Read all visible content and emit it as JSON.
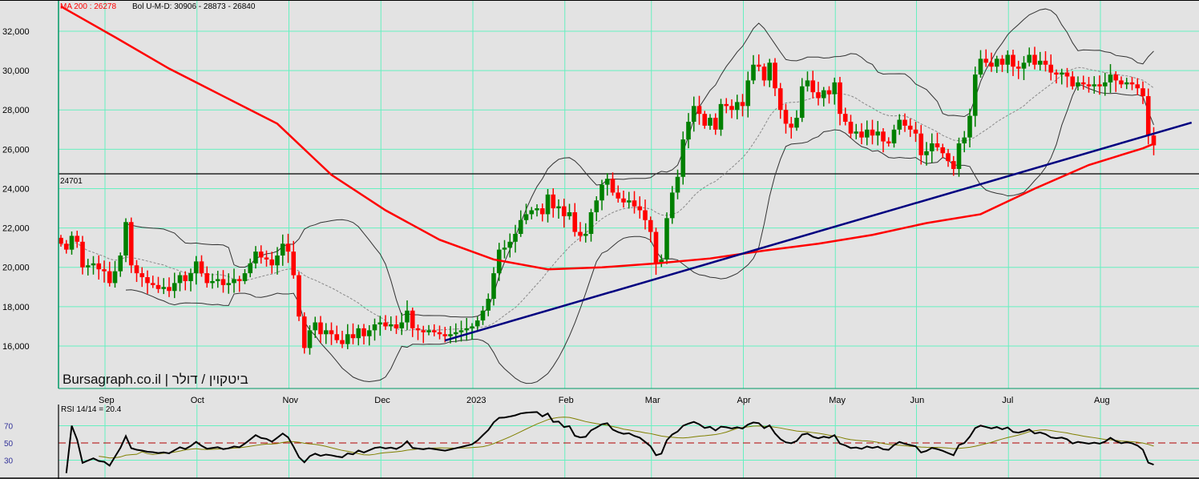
{
  "chart_data": {
    "type": "candlestick",
    "title": "Bursagraph.co.il | ביטקוין / דולר",
    "brand": "Bursagraph.co.il",
    "instrument": "ביטקוין / דולר",
    "legend": {
      "ma_label": "MA 200 : 26278",
      "bol_label": "Bol U-M-D: 30906 - 28873 - 26840",
      "rsi_label": "RSI 14/14 = 20.4"
    },
    "y_ticks": [
      "32,000",
      "30,000",
      "28,000",
      "26,000",
      "24,000",
      "22,000",
      "20,000",
      "18,000",
      "16,000"
    ],
    "y_tick_values": [
      32000,
      30000,
      28000,
      26000,
      24000,
      22000,
      20000,
      18000,
      16000
    ],
    "ylim": [
      13800,
      33600
    ],
    "reference_line": {
      "value": 24701,
      "label": "24701"
    },
    "x_months": [
      {
        "label": "Sep",
        "index": 8
      },
      {
        "label": "Oct",
        "index": 25
      },
      {
        "label": "Nov",
        "index": 42
      },
      {
        "label": "Dec",
        "index": 59
      },
      {
        "label": "2023",
        "index": 76
      },
      {
        "label": "Feb",
        "index": 93
      },
      {
        "label": "Mar",
        "index": 109
      },
      {
        "label": "Apr",
        "index": 126
      },
      {
        "label": "May",
        "index": 143
      },
      {
        "label": "Jun",
        "index": 158
      },
      {
        "label": "Jul",
        "index": 175
      },
      {
        "label": "Aug",
        "index": 192
      }
    ],
    "closes": [
      21200,
      20900,
      21600,
      21300,
      20000,
      20100,
      20200,
      19900,
      19800,
      19200,
      19800,
      20600,
      22300,
      20100,
      19700,
      19500,
      19200,
      19100,
      18900,
      19000,
      18800,
      19200,
      19600,
      19300,
      19700,
      20300,
      19700,
      19200,
      19300,
      19400,
      19100,
      19200,
      19400,
      19300,
      19700,
      20200,
      20800,
      20500,
      20400,
      20100,
      20600,
      21200,
      20800,
      19600,
      17500,
      15900,
      16800,
      17200,
      16600,
      16800,
      16600,
      16300,
      16100,
      16600,
      16400,
      16900,
      16500,
      16800,
      17100,
      17200,
      17000,
      17100,
      16900,
      17200,
      17800,
      16900,
      16800,
      16700,
      16800,
      16700,
      16600,
      16500,
      16600,
      16700,
      16800,
      16900,
      17000,
      17300,
      17800,
      18400,
      19700,
      20900,
      21000,
      21300,
      21700,
      22400,
      22700,
      22900,
      23000,
      22700,
      23700,
      23000,
      23100,
      22600,
      22800,
      21800,
      21600,
      21700,
      22800,
      23400,
      24200,
      24500,
      23800,
      23500,
      23300,
      23400,
      23100,
      22900,
      22400,
      21800,
      20200,
      20400,
      22500,
      23800,
      24600,
      26500,
      27400,
      28200,
      27800,
      27200,
      27600,
      27000,
      28300,
      28200,
      28000,
      28400,
      28200,
      29500,
      30300,
      30200,
      29500,
      30400,
      29100,
      28000,
      27300,
      27100,
      27600,
      29200,
      29500,
      28900,
      28600,
      29000,
      28800,
      29400,
      27800,
      27400,
      26800,
      26900,
      26600,
      27000,
      26700,
      26900,
      26400,
      26300,
      27000,
      27500,
      27200,
      27000,
      26800,
      25700,
      25900,
      26300,
      26100,
      25800,
      25400,
      25000,
      26300,
      26600,
      27700,
      29800,
      30600,
      30400,
      30200,
      30600,
      30300,
      30800,
      30200,
      30100,
      30400,
      30800,
      30300,
      30500,
      30300,
      29900,
      29800,
      29900,
      29700,
      29200,
      29400,
      29300,
      29200,
      29300,
      29200,
      29400,
      29800,
      29500,
      29300,
      29400,
      29300,
      29100,
      28700,
      26700,
      26200
    ],
    "ma200": {
      "every": 10,
      "values": [
        33260,
        31700,
        30100,
        28700,
        27300,
        24700,
        22900,
        21400,
        20400,
        19900,
        20000,
        20200,
        20450,
        20850,
        21200,
        21650,
        22250,
        22700,
        24000,
        25200,
        26050
      ],
      "last": 26278
    },
    "trendline": {
      "from": {
        "index": 71,
        "value": 16284
      },
      "to": {
        "index": 209,
        "value": 27358
      }
    },
    "bollinger": {
      "period": 20,
      "stddev": 2
    },
    "rsi": {
      "period": 14,
      "signal": 14,
      "levels": [
        70,
        50,
        30
      ],
      "level_labels": [
        "70",
        "50",
        "30"
      ],
      "ylim": [
        10,
        100
      ]
    },
    "colors": {
      "up": "#008000",
      "down": "#ff0000",
      "ma": "#ff0000",
      "trend": "#000080",
      "grid": "#66f0c0",
      "rsi": "#000000",
      "signal": "#808000"
    }
  }
}
